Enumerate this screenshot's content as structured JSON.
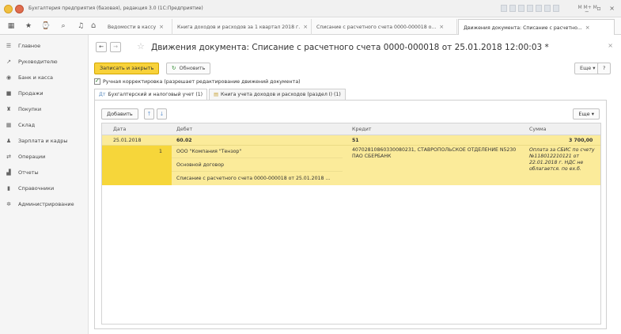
{
  "window": {
    "title": "Бухгалтерия предприятия (базовая), редакция 3.0  (1С:Предприятие)",
    "toolbar_text": "M  M+  M-"
  },
  "tabs": [
    {
      "label": "Ведомости в кассу"
    },
    {
      "label": "Книга доходов и расходов за 1 квартал 2018 г."
    },
    {
      "label": "Списание с расчетного счета 0000-000018 о..."
    },
    {
      "label": "Движения документа: Списание с расчетно..."
    }
  ],
  "sidebar": {
    "items": [
      {
        "label": "Главное",
        "icon": "menu-icon"
      },
      {
        "label": "Руководителю",
        "icon": "chart-line-icon"
      },
      {
        "label": "Банк и касса",
        "icon": "bank-icon"
      },
      {
        "label": "Продажи",
        "icon": "sales-icon"
      },
      {
        "label": "Покупки",
        "icon": "cart-icon"
      },
      {
        "label": "Склад",
        "icon": "warehouse-icon"
      },
      {
        "label": "Зарплата и кадры",
        "icon": "person-icon"
      },
      {
        "label": "Операции",
        "icon": "operations-icon"
      },
      {
        "label": "Отчеты",
        "icon": "reports-icon"
      },
      {
        "label": "Справочники",
        "icon": "book-icon"
      },
      {
        "label": "Администрирование",
        "icon": "gear-icon"
      }
    ]
  },
  "document": {
    "title": "Движения документа: Списание с расчетного счета 0000-000018 от 25.01.2018 12:00:03 *",
    "save_close_label": "Записать и закрыть",
    "refresh_label": "Обновить",
    "more_label": "Еще",
    "help_label": "?",
    "manual_correction_label": "Ручная корректировка (разрешает редактирование движений документа)"
  },
  "subtabs": [
    {
      "label": "Бухгалтерский и налоговый учет (1)"
    },
    {
      "label": "Книга учета доходов и расходов (раздел I) (1)"
    }
  ],
  "grid": {
    "add_label": "Добавить",
    "more_label": "Еще",
    "columns": {
      "date": "Дата",
      "debit": "Дебет",
      "credit": "Кредит",
      "sum": "Сумма"
    },
    "row": {
      "date": "25.01.2018",
      "debit_account": "60.02",
      "credit_account": "51",
      "sum": "3 700,00",
      "number": "1",
      "debit_sub1": "ООО \"Компания \"Тензор\"",
      "debit_sub2": "Основной договор",
      "debit_sub3": "Списание с расчетного счета 0000-000018 от 25.01.2018 ...",
      "credit_sub": "40702810860330080231, СТАВРОПОЛЬСКОЕ ОТДЕЛЕНИЕ N5230 ПАО СБЕРБАНК",
      "content": "Оплата за СБИС по счету №118012210121 от 22.01.2018 г. НДС не облагается. по ех.б."
    }
  }
}
